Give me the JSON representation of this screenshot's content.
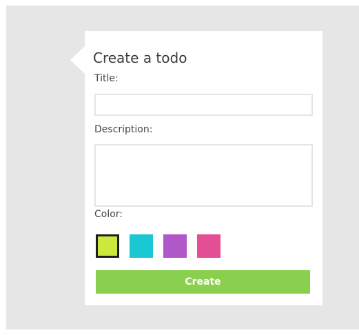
{
  "form": {
    "heading": "Create a todo",
    "title_label": "Title:",
    "title_value": "",
    "description_label": "Description:",
    "description_value": "",
    "color_label": "Color:",
    "colors": [
      {
        "name": "lime",
        "hex": "#cde83c",
        "selected": true
      },
      {
        "name": "cyan",
        "hex": "#19c8d2",
        "selected": false
      },
      {
        "name": "purple",
        "hex": "#b057c9",
        "selected": false
      },
      {
        "name": "pink",
        "hex": "#e44e92",
        "selected": false
      }
    ],
    "create_label": "Create",
    "create_color": "#8bcf4f"
  }
}
